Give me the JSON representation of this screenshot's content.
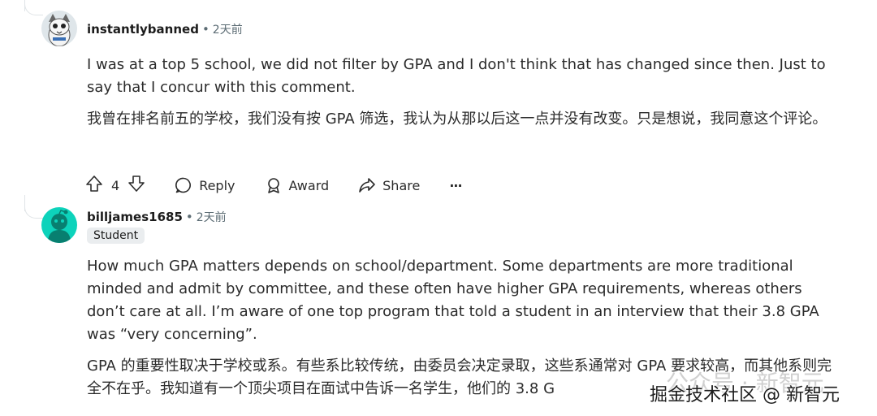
{
  "comment1": {
    "author": "instantlybanned",
    "time": "2天前",
    "body_en": "I was at a top 5 school, we did not filter by GPA and I don't think that has changed since then. Just to say that I concur with this comment.",
    "body_zh": "我曾在排名前五的学校，我们没有按 GPA 筛选，我认为从那以后这一点并没有改变。只是想说，我同意这个评论。",
    "votes": "4",
    "actions": {
      "reply": "Reply",
      "award": "Award",
      "share": "Share",
      "more": "···"
    }
  },
  "comment2": {
    "author": "billjames1685",
    "time": "2天前",
    "flair": "Student",
    "body_en": "How much GPA matters depends on school/department. Some departments are more traditional minded and admit by committee, and these often have higher GPA requirements, whereas others don’t care at all. I’m aware of one top program that told a student in an interview that their 3.8 GPA was “very concerning”.",
    "body_zh": "GPA 的重要性取决于学校或系。有些系比较传统，由委员会决定录取，这些系通常对 GPA 要求较高，而其他系则完全不在乎。我知道有一个顶尖项目在面试中告诉一名学生，他们的 3.8 G"
  },
  "separator": "•",
  "watermark": {
    "faint": "公众号 · 新智元",
    "main": "掘金技术社区 @ 新智元"
  },
  "colors": {
    "meta": "#5c6c74",
    "thread": "#e0e4e7",
    "avatar2": "#0dd3bb"
  },
  "icons": [
    "upvote-icon",
    "downvote-icon",
    "comment-icon",
    "award-icon",
    "share-icon"
  ]
}
